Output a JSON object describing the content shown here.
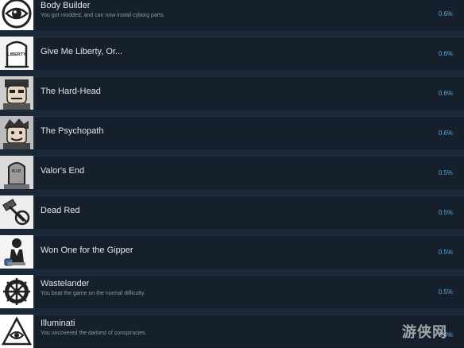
{
  "achievements": [
    {
      "title": "Body Builder",
      "description": "You got modded, and can now install cyborg parts.",
      "percent": "0.6%",
      "icon": "eye-icon"
    },
    {
      "title": "Give Me Liberty, Or...",
      "description": "",
      "percent": "0.6%",
      "icon": "liberty-tombstone-icon"
    },
    {
      "title": "The Hard-Head",
      "description": "",
      "percent": "0.6%",
      "icon": "hard-head-portrait-icon"
    },
    {
      "title": "The Psychopath",
      "description": "",
      "percent": "0.6%",
      "icon": "psychopath-portrait-icon"
    },
    {
      "title": "Valor's End",
      "description": "",
      "percent": "0.5%",
      "icon": "rip-tombstone-icon"
    },
    {
      "title": "Dead Red",
      "description": "",
      "percent": "0.5%",
      "icon": "crossed-out-hammer-icon"
    },
    {
      "title": "Won One for the Gipper",
      "description": "",
      "percent": "0.5%",
      "icon": "gipper-figure-icon"
    },
    {
      "title": "Wastelander",
      "description": "You beat the game on the normal difficulty.",
      "percent": "0.5%",
      "icon": "wasteland-wheel-icon"
    },
    {
      "title": "Illuminati",
      "description": "You uncovered the darkest of conspiracies.",
      "percent": "0.4%",
      "icon": "illuminati-pyramid-icon"
    }
  ],
  "icon_text": {
    "liberty": "LIBERTY",
    "rip": "R.I.P."
  },
  "watermark": "游侠网"
}
